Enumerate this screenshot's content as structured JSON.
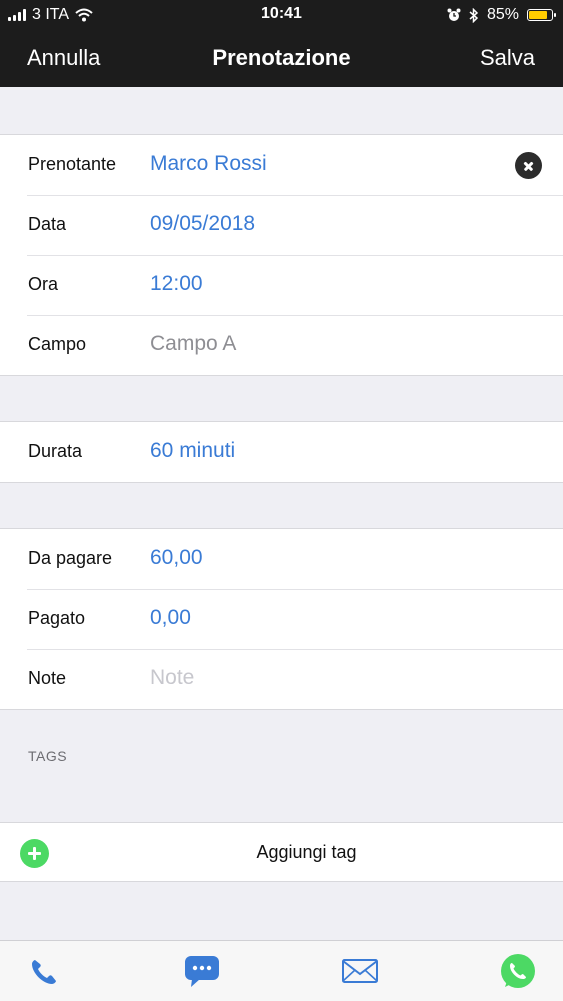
{
  "status_bar": {
    "carrier": "3 ITA",
    "time": "10:41",
    "battery_percent": "85%",
    "battery_level": 0.85,
    "icons": [
      "signal-icon",
      "wifi-icon",
      "alarm-icon",
      "bluetooth-icon",
      "battery-icon"
    ]
  },
  "nav": {
    "cancel_label": "Annulla",
    "title": "Prenotazione",
    "save_label": "Salva"
  },
  "booking": {
    "prenotante": {
      "label": "Prenotante",
      "value": "Marco Rossi"
    },
    "data": {
      "label": "Data",
      "value": "09/05/2018"
    },
    "ora": {
      "label": "Ora",
      "value": "12:00"
    },
    "campo": {
      "label": "Campo",
      "value": "Campo A"
    }
  },
  "duration": {
    "label": "Durata",
    "value": "60 minuti"
  },
  "payment": {
    "da_pagare": {
      "label": "Da pagare",
      "value": "60,00"
    },
    "pagato": {
      "label": "Pagato",
      "value": "0,00"
    },
    "note": {
      "label": "Note",
      "placeholder": "Note"
    }
  },
  "tags": {
    "header": "TAGS",
    "add_label": "Aggiungi tag"
  },
  "tabbar": {
    "items": [
      "phone-icon",
      "chat-icon",
      "mail-icon",
      "whatsapp-icon"
    ]
  },
  "colors": {
    "accent": "#3a7bd5",
    "bar_background": "#1c1c1c",
    "add_button": "#4cd964",
    "whatsapp": "#4cd964",
    "battery": "#ffcc00"
  }
}
